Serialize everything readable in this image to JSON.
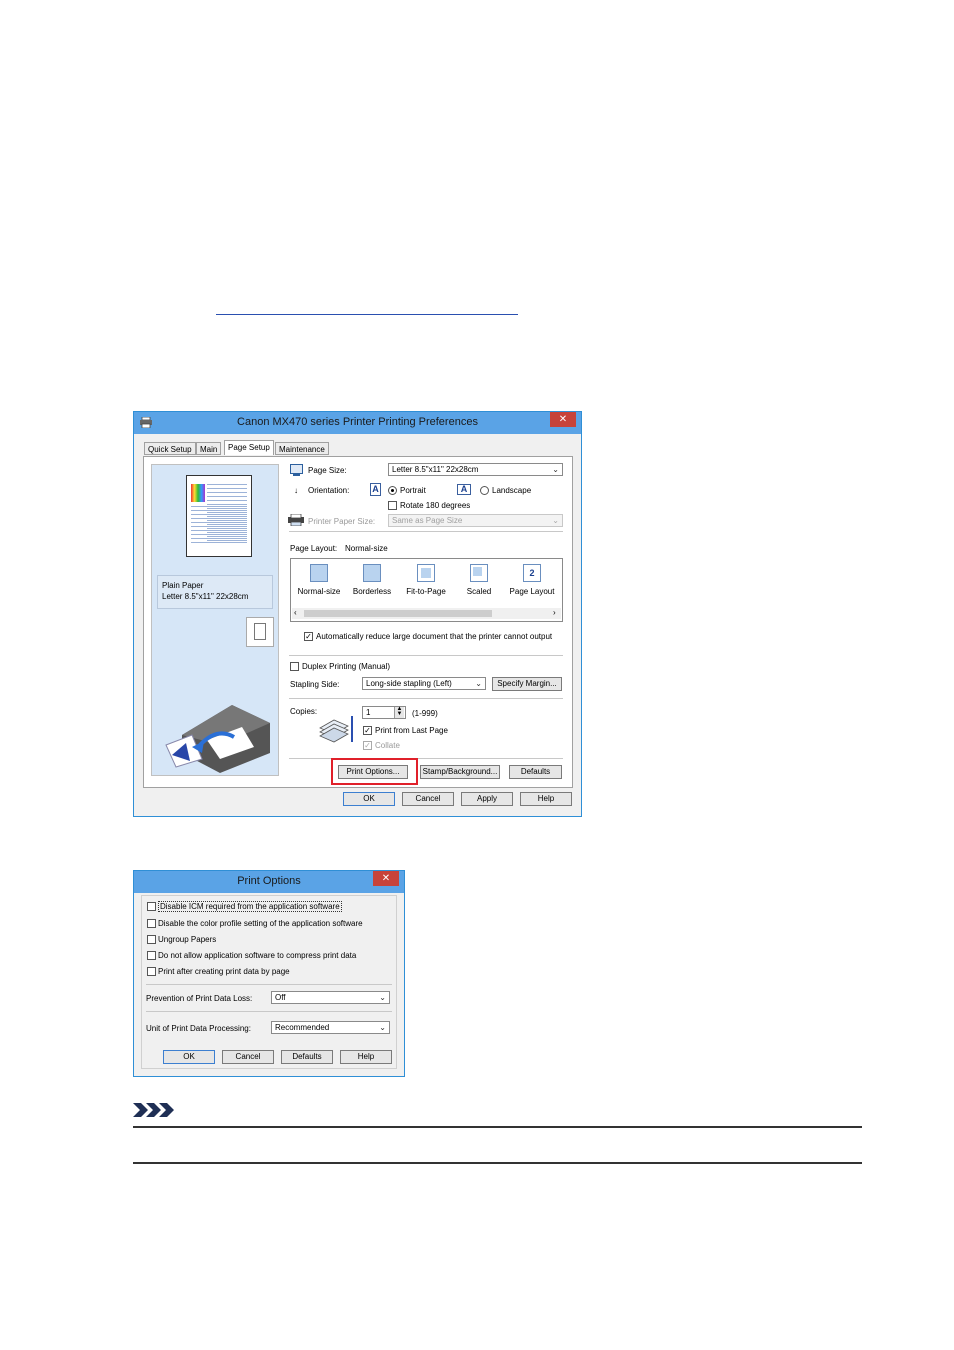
{
  "main_window": {
    "title": "Canon MX470 series Printer Printing Preferences",
    "close": "✕",
    "tabs": [
      "Quick Setup",
      "Main",
      "Page Setup",
      "Maintenance"
    ],
    "active_tab": "Page Setup",
    "preview_media": "Plain Paper",
    "preview_size": "Letter 8.5\"x11\" 22x28cm",
    "page_size_label": "Page Size:",
    "page_size_value": "Letter 8.5\"x11\" 22x28cm",
    "orientation_label": "Orientation:",
    "portrait_label": "Portrait",
    "landscape_label": "Landscape",
    "orientation_icon_text": "A",
    "rotate_label": "Rotate 180 degrees",
    "printer_paper_size_label": "Printer Paper Size:",
    "printer_paper_size_value": "Same as Page Size",
    "page_layout_label": "Page Layout:",
    "page_layout_value": "Normal-size",
    "layout_options": [
      "Normal-size",
      "Borderless",
      "Fit-to-Page",
      "Scaled",
      "Page Layout"
    ],
    "page_layout_icon_num": "2",
    "auto_reduce_label": "Automatically reduce large document that the printer cannot output",
    "duplex_label": "Duplex Printing (Manual)",
    "stapling_side_label": "Stapling Side:",
    "stapling_side_value": "Long-side stapling (Left)",
    "specify_margin": "Specify Margin...",
    "copies_label": "Copies:",
    "copies_value": "1",
    "copies_range": "(1-999)",
    "print_from_last_label": "Print from Last Page",
    "collate_label": "Collate",
    "print_options_button": "Print Options...",
    "stamp_background_button": "Stamp/Background...",
    "defaults_button": "Defaults",
    "ok_button": "OK",
    "cancel_button": "Cancel",
    "apply_button": "Apply",
    "help_button": "Help"
  },
  "print_options_window": {
    "title": "Print Options",
    "close": "✕",
    "checkboxes": [
      "Disable ICM required from the application software",
      "Disable the color profile setting of the application software",
      "Ungroup Papers",
      "Do not allow application software to compress print data",
      "Print after creating print data by page"
    ],
    "prevention_label": "Prevention of Print Data Loss:",
    "prevention_value": "Off",
    "unit_label": "Unit of Print Data Processing:",
    "unit_value": "Recommended",
    "ok_button": "OK",
    "cancel_button": "Cancel",
    "defaults_button": "Defaults",
    "help_button": "Help"
  },
  "colors": {
    "title_bar": "#5aa3e6",
    "close_button": "#c7433a",
    "highlight": "#e0202a",
    "preview_bg": "#d6e6f7"
  }
}
